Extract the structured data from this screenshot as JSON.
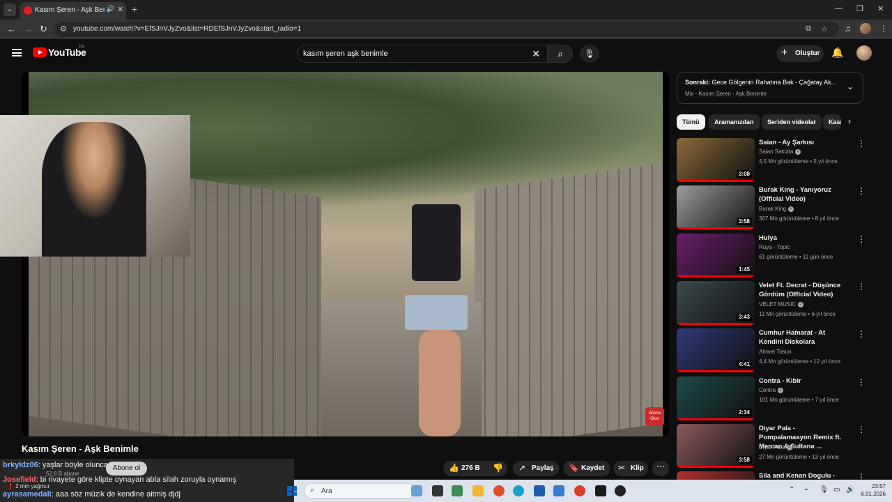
{
  "browser": {
    "tab_title": "Kasım Şeren - Aşk Benimle",
    "url": "youtube.com/watch?v=EfSJnVJyZvo&list=RDEfSJnVJyZvo&start_radio=1"
  },
  "masthead": {
    "logo_text": "YouTube",
    "region": "TR",
    "search_query": "kasım şeren aşk benimle",
    "create_label": "Oluştur"
  },
  "player": {
    "overlay_badge": "Abone Olun"
  },
  "video": {
    "title": "Kasım Şeren - Aşk Benimle",
    "subscribers": "52,8 B abone",
    "subscribe_label": "Abone ol",
    "likes": "276 B",
    "share_label": "Paylaş",
    "save_label": "Kaydet",
    "clip_label": "Klip"
  },
  "chat": [
    {
      "user": "brkyldz06",
      "message": ": yaşlar böyle olunca",
      "user_color": "#7fb4ff"
    },
    {
      "user": "Josefield",
      "message": ": bi rivayete göre klipte oynayan abla silah zoruyla oynamış",
      "user_color": "#ff6a6a"
    },
    {
      "user": "ayrasamedali",
      "message": ": aaa söz müzik de kendine aitmiş djdj",
      "user_color": "#7fb4ff"
    }
  ],
  "chat_notice": "2 mm yağmur",
  "up_next": {
    "prefix": "Sonraki:",
    "title": "Gece Gölgenin Rahatına Bak - Çağatay Ak...",
    "subtitle": "Mix - Kasım Şeren - Aşk Benimle"
  },
  "chips": [
    "Tümü",
    "Aramanızdan",
    "Seriden videolar",
    "Kasım Şeren"
  ],
  "recommendations": [
    {
      "title": "Saian - Ay Şarkısı",
      "channel": "Saian Sakulta",
      "verified": true,
      "meta": "4,5 Mn görüntüleme • 5 yıl önce",
      "duration": "3:08",
      "thumb_color": "#8a6a3a"
    },
    {
      "title": "Burak King - Yanıyoruz (Official Video)",
      "channel": "Burak King",
      "verified": true,
      "meta": "307 Mn görüntüleme • 8 yıl önce",
      "duration": "3:58",
      "thumb_color": "#9c9c9c"
    },
    {
      "title": "Hulya",
      "channel": "Ruya - Topic",
      "verified": false,
      "meta": "61 görüntüleme • 11 gün önce",
      "duration": "1:45",
      "thumb_color": "#6b1e6b"
    },
    {
      "title": "Velet Ft. Decrat - Düşünce Gördüm (Official Video)",
      "channel": "VELET MUSIC",
      "verified": true,
      "meta": "11 Mn görüntüleme • 6 yıl önce",
      "duration": "3:43",
      "thumb_color": "#3b4a4f"
    },
    {
      "title": "Cumhur Hamarat - At Kendini Diskolara",
      "channel": "Ahmet Tosun",
      "verified": false,
      "meta": "4,4 Mn görüntüleme • 12 yıl önce",
      "duration": "4:41",
      "thumb_color": "#2e3b7a"
    },
    {
      "title": "Contra - Kibir",
      "channel": "Contra",
      "verified": true,
      "meta": "101 Mn görüntüleme • 7 yıl önce",
      "duration": "2:34",
      "thumb_color": "#1f4a4a"
    },
    {
      "title": "Diyar Pala - Pompalamasyon Remix ft. Mercan & Sultana ...",
      "channel": "Diyar Pala",
      "verified": true,
      "meta": "27 Mn görüntüleme • 13 yıl önce",
      "duration": "3:58",
      "thumb_color": "#8c5a5a"
    },
    {
      "title": "Sila and Kenan Dogulu - ...dan",
      "channel": "",
      "verified": false,
      "meta": "",
      "duration": "",
      "thumb_color": "#b23030"
    }
  ],
  "taskbar": {
    "search_placeholder": "Ara",
    "time": "23:57",
    "date": "6.01.2026"
  }
}
